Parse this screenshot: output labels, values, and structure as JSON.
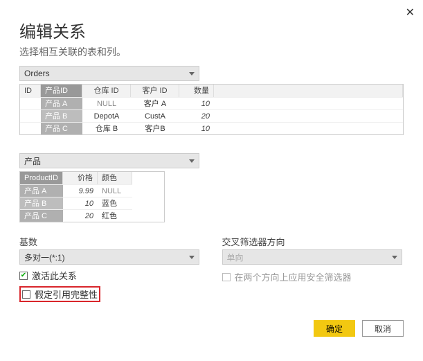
{
  "dialog": {
    "title": "编辑关系",
    "subtitle": "选择相互关联的表和列。",
    "close_icon": "✕"
  },
  "table1": {
    "dropdown": "Orders",
    "headers": {
      "id": "ID",
      "product_id": "产品ID",
      "depot_id": "仓库 ID",
      "customer_id": "客户 ID",
      "qty": "数量"
    },
    "rows": [
      {
        "product": "产品 A",
        "depot": "NULL",
        "customer": "客户 A",
        "qty": "10"
      },
      {
        "product": "产品 B",
        "depot": "DepotA",
        "customer": "CustA",
        "qty": "20"
      },
      {
        "product": "产品 C",
        "depot": "仓库 B",
        "customer": "客户B",
        "qty": "10"
      }
    ]
  },
  "table2": {
    "dropdown": "产品",
    "headers": {
      "product_id": "ProductID",
      "price": "价格",
      "color": "颜色"
    },
    "rows": [
      {
        "product": "产品 A",
        "price": "9.99",
        "color": "NULL"
      },
      {
        "product": "产品 B",
        "price": "10",
        "color": "蓝色"
      },
      {
        "product": "产品 C",
        "price": "20",
        "color": "红色"
      }
    ]
  },
  "form": {
    "cardinality_label": "基数",
    "cardinality_value": "多对一(*:1)",
    "crossfilter_label": "交叉筛选器方向",
    "crossfilter_value": "单向",
    "activate_label": "激活此关系",
    "security_label": "在两个方向上应用安全筛选器",
    "integrity_label": "假定引用完整性"
  },
  "footer": {
    "ok": "确定",
    "cancel": "取消"
  }
}
